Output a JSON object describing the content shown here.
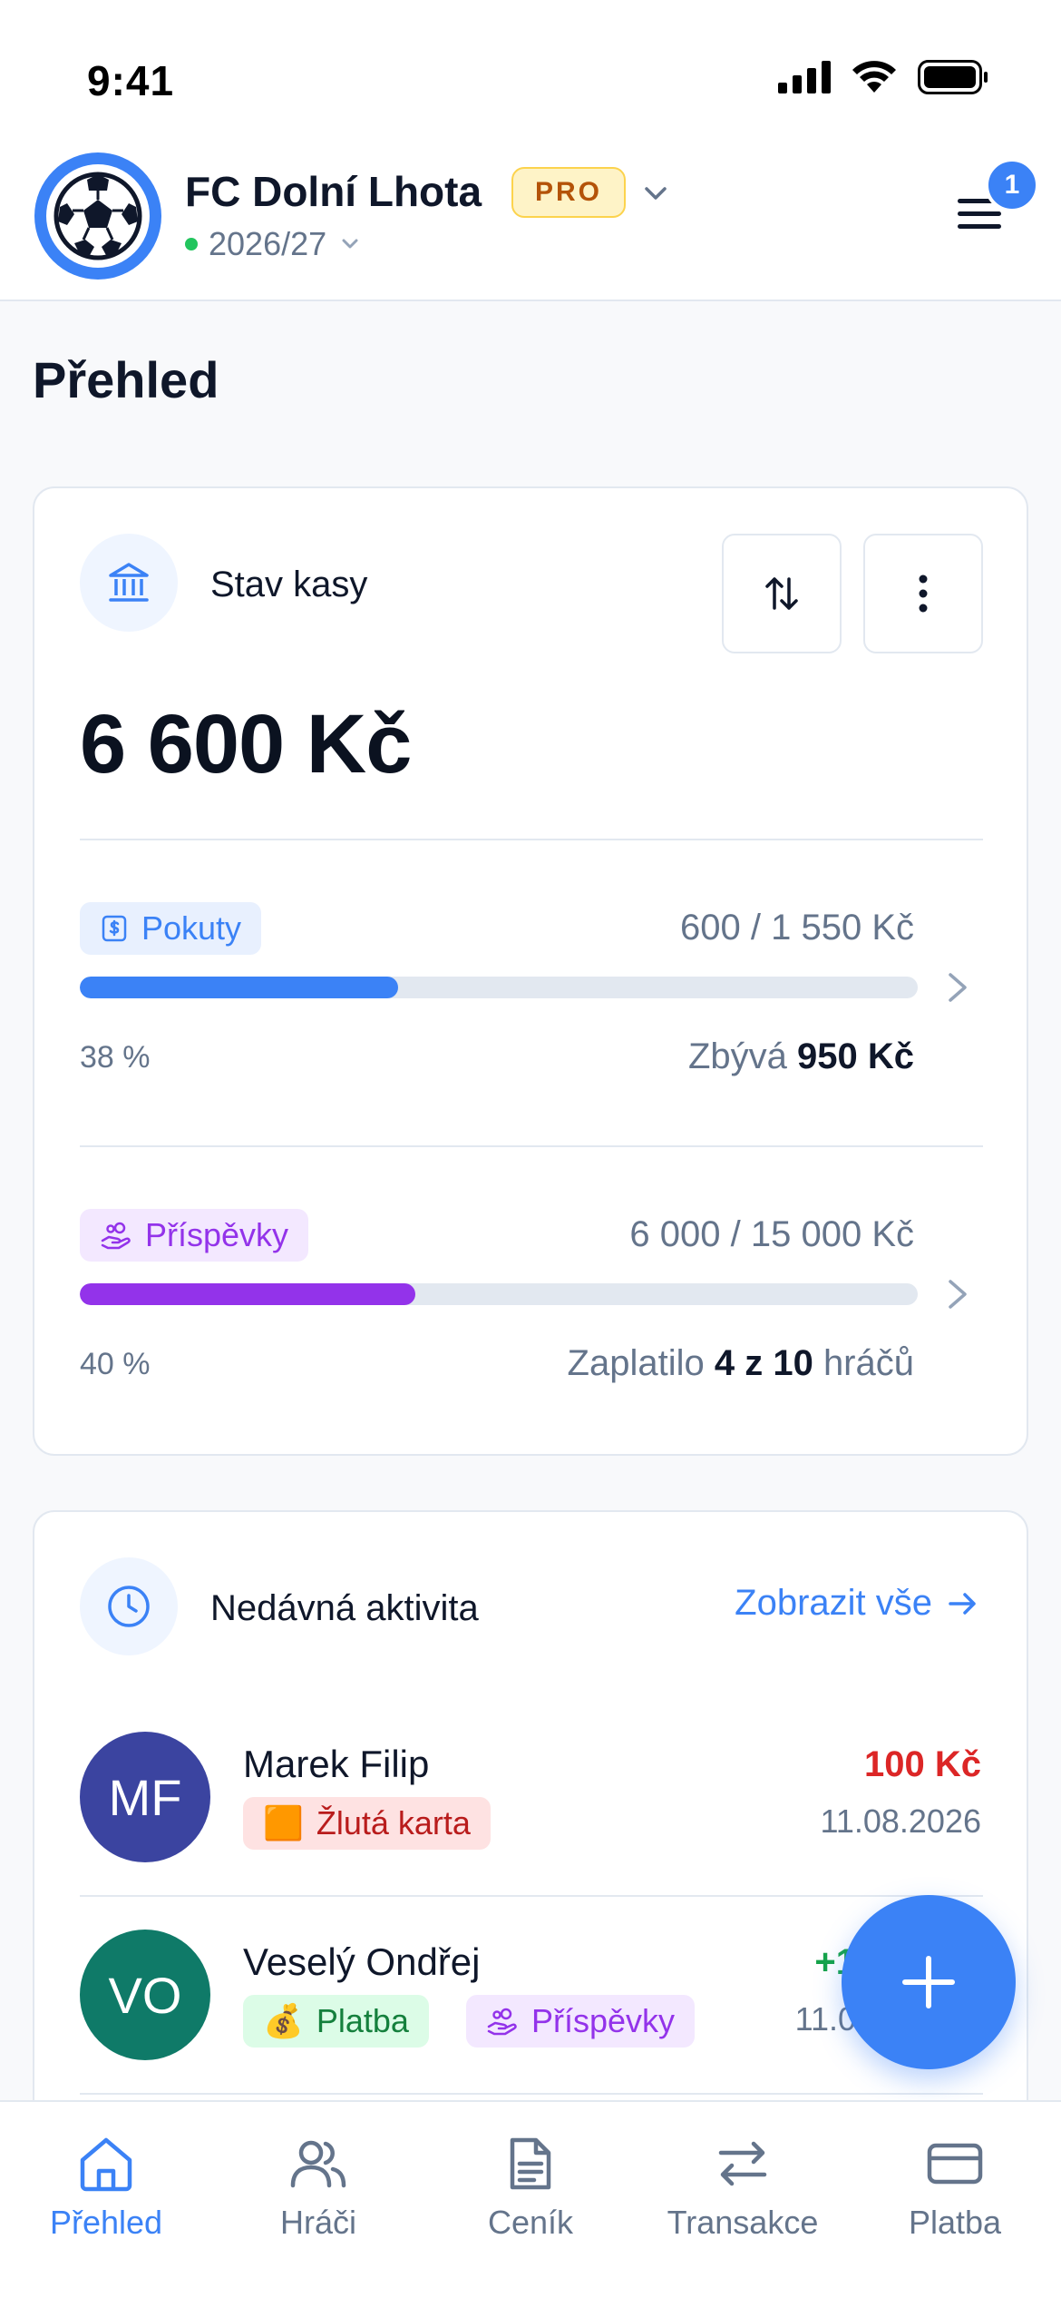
{
  "status_bar": {
    "time": "9:41"
  },
  "header": {
    "club_name": "FC Dolní Lhota",
    "plan_badge": "PRO",
    "season": "2026/27",
    "notification_count": "1"
  },
  "page_title": "Přehled",
  "cash_card": {
    "label": "Stav kasy",
    "balance": "6 600 Kč",
    "fines": {
      "label": "Pokuty",
      "amount": "600 / 1 550 Kč",
      "progress_percent": 38,
      "percent_label": "38 %",
      "remaining_prefix": "Zbývá",
      "remaining_value": "950 Kč"
    },
    "contributions": {
      "label": "Příspěvky",
      "amount": "6 000 / 15 000 Kč",
      "progress_percent": 40,
      "percent_label": "40 %",
      "paid_prefix": "Zaplatilo",
      "paid_value": "4 z 10",
      "paid_suffix": "hráčů"
    }
  },
  "activity_card": {
    "label": "Nedávná aktivita",
    "view_all": "Zobrazit vše",
    "items": [
      {
        "initials": "MF",
        "avatar_color": "#3b44a0",
        "name": "Marek Filip",
        "tags": [
          {
            "emoji": "🟧",
            "label": "Žlutá karta"
          }
        ],
        "amount": "100 Kč",
        "amount_color": "#dc2626",
        "date": "11.08.2026"
      },
      {
        "initials": "VO",
        "avatar_color": "#0f7a68",
        "name": "Veselý Ondřej",
        "tags": [
          {
            "emoji": "💰",
            "label": "Platba"
          },
          {
            "label": "Příspěvky"
          }
        ],
        "amount": "+1",
        "amount_color": "#16a34a",
        "date": "11.0"
      }
    ]
  },
  "bottom_nav": [
    {
      "label": "Přehled",
      "icon": "home-icon",
      "active": true
    },
    {
      "label": "Hráči",
      "icon": "users-icon",
      "active": false
    },
    {
      "label": "Ceník",
      "icon": "document-icon",
      "active": false
    },
    {
      "label": "Transakce",
      "icon": "arrows-icon",
      "active": false
    },
    {
      "label": "Platba",
      "icon": "card-icon",
      "active": false
    }
  ],
  "colors": {
    "accent": "#3b82f6",
    "purple": "#9333ea",
    "danger": "#dc2626",
    "success": "#16a34a"
  }
}
